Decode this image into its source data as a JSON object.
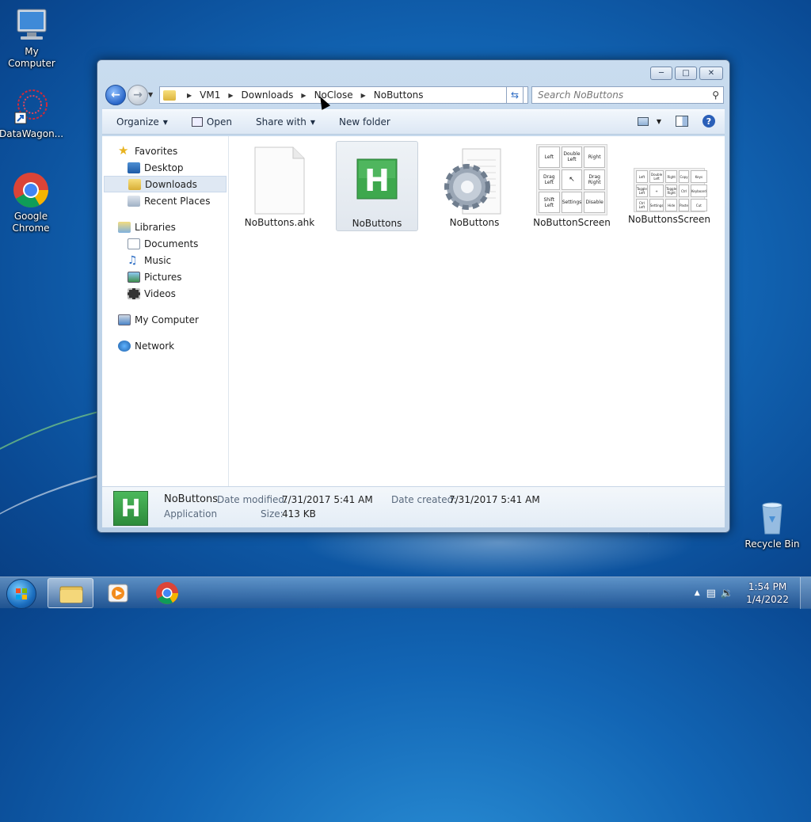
{
  "desktop": {
    "icons": [
      {
        "label": "My Computer"
      },
      {
        "label": "DataWagon..."
      },
      {
        "label": "Google Chrome"
      },
      {
        "label": "Recycle Bin"
      }
    ]
  },
  "window": {
    "address": {
      "crumbs": [
        "VM1",
        "Downloads",
        "NoClose",
        "NoButtons"
      ]
    },
    "search_placeholder": "Search NoButtons",
    "toolbar": {
      "organize": "Organize",
      "open": "Open",
      "share_with": "Share with",
      "new_folder": "New folder"
    },
    "nav_pane": {
      "favorites": "Favorites",
      "desktop": "Desktop",
      "downloads": "Downloads",
      "recent_places": "Recent Places",
      "libraries": "Libraries",
      "documents": "Documents",
      "music": "Music",
      "pictures": "Pictures",
      "videos": "Videos",
      "my_computer": "My Computer",
      "network": "Network"
    },
    "files": [
      {
        "name": "NoButtons.ahk"
      },
      {
        "name": "NoButtons"
      },
      {
        "name": "NoButtons"
      },
      {
        "name": "NoButtonScreen"
      },
      {
        "name": "NoButtonsScreen"
      }
    ],
    "thumb_buttons_1": [
      "Left",
      "Double Left",
      "Right",
      "Drag Left",
      "",
      "Drag Right",
      "Shift Left",
      "Settings",
      "Disable"
    ],
    "thumb_buttons_2": [
      "Left",
      "Double Left",
      "Right",
      "Copy",
      "Keys",
      "Toggle Left",
      "+",
      "Toggle Right",
      "Ctrl",
      "Keyboard",
      "Ctrl Left",
      "Settings",
      "Hide",
      "Paste",
      "Cut"
    ],
    "details": {
      "name": "NoButtons",
      "type": "Application",
      "date_modified_label": "Date modified:",
      "date_modified": "7/31/2017 5:41 AM",
      "date_created_label": "Date created:",
      "date_created": "7/31/2017 5:41 AM",
      "size_label": "Size:",
      "size": "413 KB",
      "icon_letter": "H"
    }
  },
  "taskbar": {
    "time": "1:54 PM",
    "date": "1/4/2022"
  },
  "colors": {
    "ahk_green": "#3ea84d",
    "accent_blue": "#2a66c8"
  }
}
